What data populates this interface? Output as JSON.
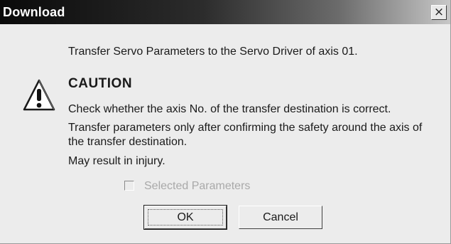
{
  "dialog": {
    "title": "Download",
    "close_glyph": "×",
    "intro": "Transfer Servo Parameters to the Servo Driver of axis 01.",
    "icon": "warning-exclamation-icon",
    "caution": {
      "heading": "CAUTION",
      "line1": "Check whether the axis No. of the transfer destination is correct.",
      "line2a": "Transfer parameters only after confirming the safety around the axis of",
      "line2b": "the transfer destination.",
      "line3": "May result in injury."
    },
    "checkbox": {
      "label": "Selected Parameters",
      "checked": false,
      "enabled": false
    },
    "buttons": {
      "ok_label": "OK",
      "cancel_label": "Cancel"
    },
    "colors": {
      "title_bar": "#0a0a0a",
      "face": "#ececec",
      "disabled_text": "#a9a9a9"
    }
  }
}
